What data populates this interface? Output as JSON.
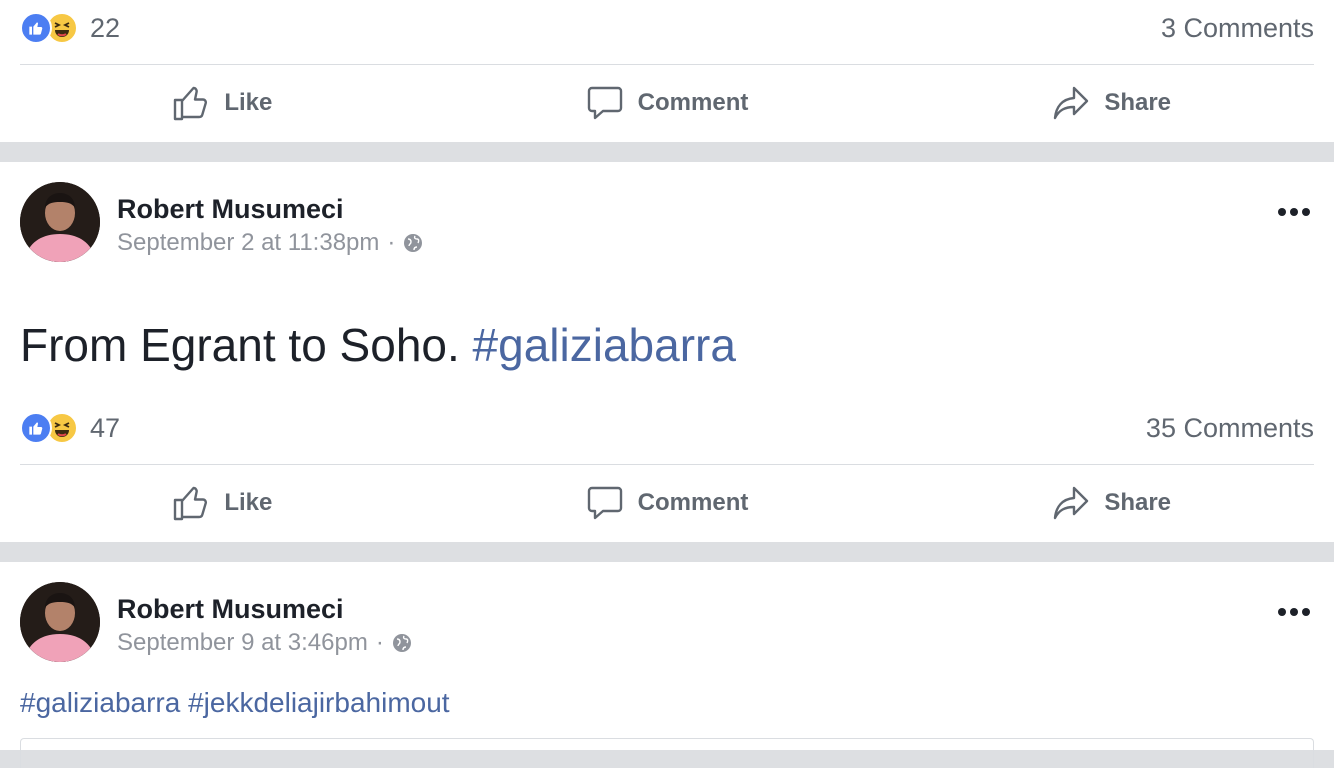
{
  "colors": {
    "like_blue": "#4c7ef2",
    "haha_yellow": "#f7c844",
    "hashtag_blue": "#4b67a1",
    "secondary_text": "#606770",
    "separator": "#dddfe2"
  },
  "top_post": {
    "reaction_count": "22",
    "comments_label": "3 Comments"
  },
  "actions": {
    "like": "Like",
    "comment": "Comment",
    "share": "Share",
    "icons": [
      "thumbs-up-icon",
      "comment-bubble-icon",
      "share-arrow-icon"
    ]
  },
  "posts": [
    {
      "author": "Robert Musumeci",
      "timestamp": "September 2 at 11:38pm",
      "separator": "·",
      "privacy_icon": "globe-icon",
      "text": "From Egrant to Soho.",
      "hashtag": "#galiziabarra",
      "reaction_count": "47",
      "comments_label": "35 Comments"
    },
    {
      "author": "Robert Musumeci",
      "timestamp": "September 9 at 3:46pm",
      "separator": "·",
      "privacy_icon": "globe-icon",
      "text": "#galiziabarra #jekkdeliajirbahimout"
    }
  ]
}
